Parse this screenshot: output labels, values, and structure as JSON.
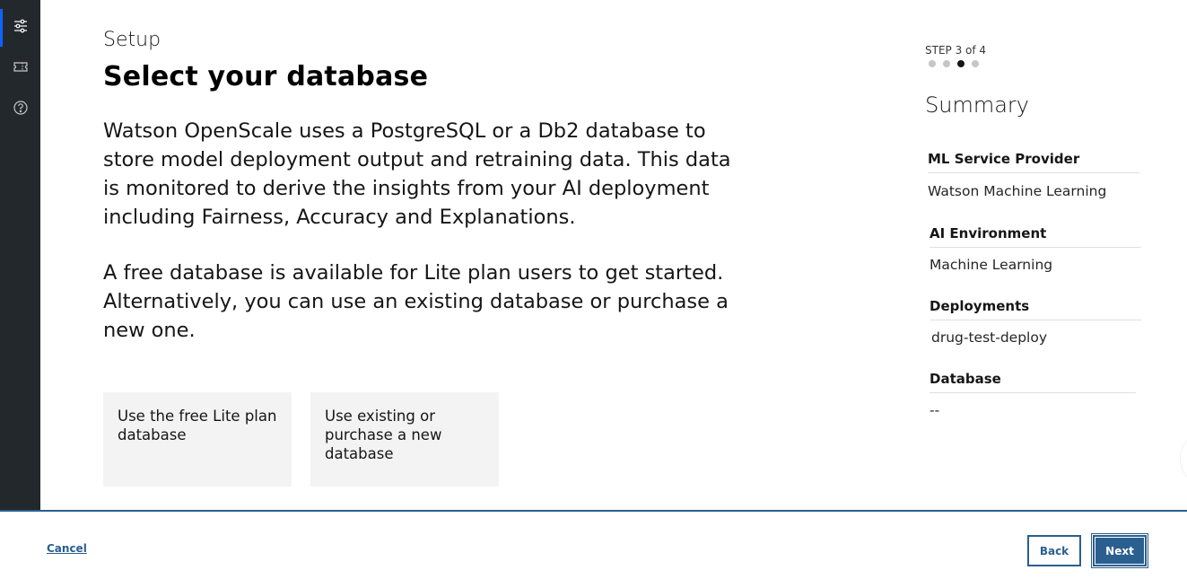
{
  "sidebar": {
    "items": [
      {
        "icon": "settings-sliders-icon",
        "active": true
      },
      {
        "icon": "ticket-icon",
        "active": false
      },
      {
        "icon": "help-icon",
        "active": false
      }
    ]
  },
  "header": {
    "setup_label": "Setup",
    "title": "Select your database"
  },
  "main": {
    "description_1": "Watson OpenScale uses a PostgreSQL or a Db2 database to store model deployment output and retraining data. This data is monitored to derive the insights from your AI deployment including Fairness, Accuracy and Explanations.",
    "description_2": "A free database is available for Lite plan users to get started. Alternatively, you can use an existing database or purchase a new one.",
    "tiles": [
      {
        "label": "Use the free Lite plan database"
      },
      {
        "label": "Use existing or purchase a new database"
      }
    ]
  },
  "progress": {
    "step_label": "STEP 3 of 4",
    "total_steps": 4,
    "current_step": 3
  },
  "summary": {
    "title": "Summary",
    "sections": [
      {
        "heading": "ML Service Provider",
        "value": "Watson Machine Learning"
      },
      {
        "heading": "AI Environment",
        "value": "Machine Learning"
      },
      {
        "heading": "Deployments",
        "value": "drug-test-deploy"
      },
      {
        "heading": "Database",
        "value": "--"
      }
    ]
  },
  "footer": {
    "cancel_label": "Cancel",
    "back_label": "Back",
    "next_label": "Next"
  },
  "colors": {
    "sidebar_bg": "#23282d",
    "accent": "#2a5f8f",
    "active_indicator": "#0f62fe",
    "tile_bg": "#f3f3f3"
  }
}
